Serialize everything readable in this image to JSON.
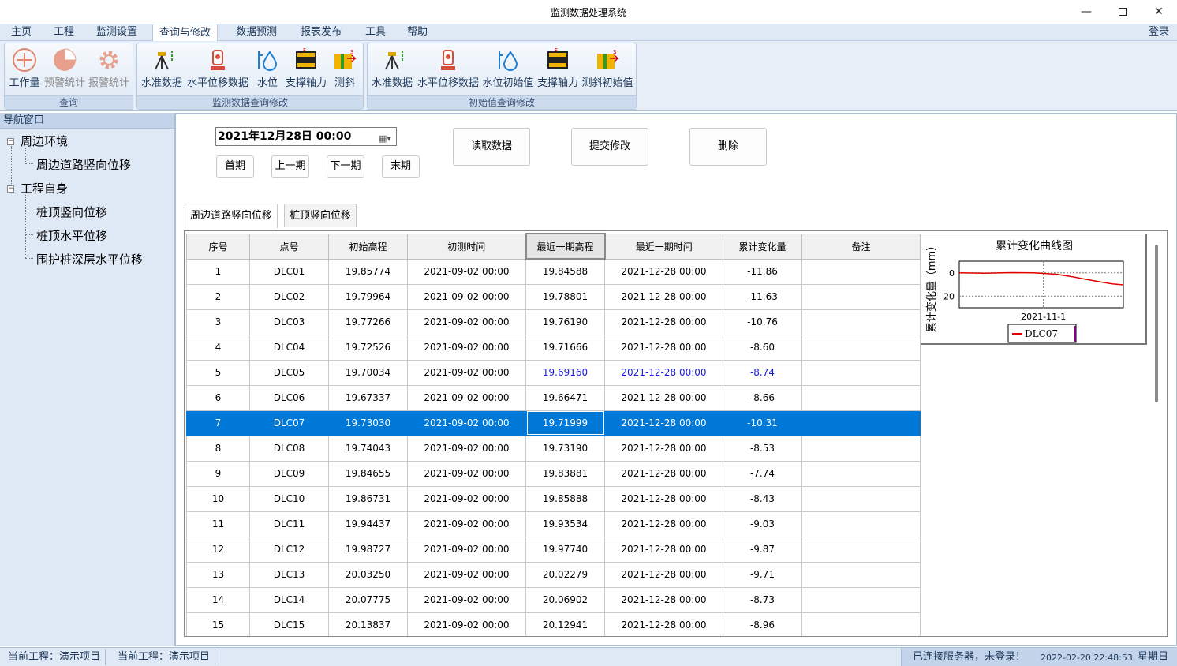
{
  "window": {
    "title": "监测数据处理系统"
  },
  "menu": {
    "items": [
      "主页",
      "工程",
      "监测设置",
      "查询与修改",
      "数据预测",
      "报表发布",
      "工具",
      "帮助"
    ],
    "active_index": 3,
    "login": "登录"
  },
  "ribbon": {
    "groups": [
      {
        "label": "查询",
        "buttons": [
          "工作量",
          "预警统计",
          "报警统计"
        ]
      },
      {
        "label": "监测数据查询修改",
        "buttons": [
          "水准数据",
          "水平位移数据",
          "水位",
          "支撑轴力",
          "测斜"
        ]
      },
      {
        "label": "初始值查询修改",
        "buttons": [
          "水准数据",
          "水平位移数据",
          "水位初始值",
          "支撑轴力",
          "测斜初始值"
        ]
      }
    ]
  },
  "nav": {
    "header": "导航窗口",
    "tree": [
      {
        "label": "周边环境",
        "children": [
          "周边道路竖向位移"
        ]
      },
      {
        "label": "工程自身",
        "children": [
          "桩顶竖向位移",
          "桩顶水平位移",
          "围护桩深层水平位移"
        ]
      }
    ]
  },
  "controls": {
    "date": "2021年12月28日 00:00",
    "nav_buttons": [
      "首期",
      "上一期",
      "下一期",
      "末期"
    ],
    "read": "读取数据",
    "submit": "提交修改",
    "delete": "删除"
  },
  "tabs": [
    "周边道路竖向位移",
    "桩顶竖向位移"
  ],
  "grid": {
    "columns": [
      "序号",
      "点号",
      "初始高程",
      "初测时间",
      "最近一期高程",
      "最近一期时间",
      "累计变化量",
      "备注"
    ],
    "selected_row": 6,
    "blue_row": 4,
    "rows": [
      [
        "1",
        "DLC01",
        "19.85774",
        "2021-09-02 00:00",
        "19.84588",
        "2021-12-28 00:00",
        "-11.86",
        ""
      ],
      [
        "2",
        "DLC02",
        "19.79964",
        "2021-09-02 00:00",
        "19.78801",
        "2021-12-28 00:00",
        "-11.63",
        ""
      ],
      [
        "3",
        "DLC03",
        "19.77266",
        "2021-09-02 00:00",
        "19.76190",
        "2021-12-28 00:00",
        "-10.76",
        ""
      ],
      [
        "4",
        "DLC04",
        "19.72526",
        "2021-09-02 00:00",
        "19.71666",
        "2021-12-28 00:00",
        "-8.60",
        ""
      ],
      [
        "5",
        "DLC05",
        "19.70034",
        "2021-09-02 00:00",
        "19.69160",
        "2021-12-28 00:00",
        "-8.74",
        ""
      ],
      [
        "6",
        "DLC06",
        "19.67337",
        "2021-09-02 00:00",
        "19.66471",
        "2021-12-28 00:00",
        "-8.66",
        ""
      ],
      [
        "7",
        "DLC07",
        "19.73030",
        "2021-09-02 00:00",
        "19.71999",
        "2021-12-28 00:00",
        "-10.31",
        ""
      ],
      [
        "8",
        "DLC08",
        "19.74043",
        "2021-09-02 00:00",
        "19.73190",
        "2021-12-28 00:00",
        "-8.53",
        ""
      ],
      [
        "9",
        "DLC09",
        "19.84655",
        "2021-09-02 00:00",
        "19.83881",
        "2021-12-28 00:00",
        "-7.74",
        ""
      ],
      [
        "10",
        "DLC10",
        "19.86731",
        "2021-09-02 00:00",
        "19.85888",
        "2021-12-28 00:00",
        "-8.43",
        ""
      ],
      [
        "11",
        "DLC11",
        "19.94437",
        "2021-09-02 00:00",
        "19.93534",
        "2021-12-28 00:00",
        "-9.03",
        ""
      ],
      [
        "12",
        "DLC12",
        "19.98727",
        "2021-09-02 00:00",
        "19.97740",
        "2021-12-28 00:00",
        "-9.87",
        ""
      ],
      [
        "13",
        "DLC13",
        "20.03250",
        "2021-09-02 00:00",
        "20.02279",
        "2021-12-28 00:00",
        "-9.71",
        ""
      ],
      [
        "14",
        "DLC14",
        "20.07775",
        "2021-09-02 00:00",
        "20.06902",
        "2021-12-28 00:00",
        "-8.73",
        ""
      ],
      [
        "15",
        "DLC15",
        "20.13837",
        "2021-09-02 00:00",
        "20.12941",
        "2021-12-28 00:00",
        "-8.96",
        ""
      ]
    ]
  },
  "chart": {
    "title": "累计变化曲线图",
    "ylabel": "累计变化量（mm）",
    "xtick": "2021-11-1",
    "yticks": [
      "0",
      "-20"
    ],
    "legend": "DLC07",
    "line_color": "#e00000"
  },
  "chart_data": {
    "type": "line",
    "title": "累计变化曲线图",
    "ylabel": "累计变化量（mm）",
    "xlabel": "",
    "ylim": [
      -30,
      10
    ],
    "x_tick_labels": [
      "2021-11-1"
    ],
    "y_ticks": [
      0,
      -20
    ],
    "series": [
      {
        "name": "DLC07",
        "x": [
          "2021-09-02",
          "2021-09-20",
          "2021-10-10",
          "2021-10-25",
          "2021-11-01",
          "2021-11-10",
          "2021-11-20",
          "2021-12-01",
          "2021-12-10",
          "2021-12-20",
          "2021-12-28"
        ],
        "values": [
          0,
          -0.3,
          0.2,
          0,
          -0.5,
          -1.2,
          -3,
          -5.5,
          -7.5,
          -9.5,
          -10.31
        ]
      }
    ]
  },
  "status": {
    "project1": "当前工程：演示项目",
    "project2": "当前工程：演示项目",
    "server": "已连接服务器，未登录！",
    "datetime": "2022-02-20 22:48:53",
    "weekday": "星期日"
  }
}
